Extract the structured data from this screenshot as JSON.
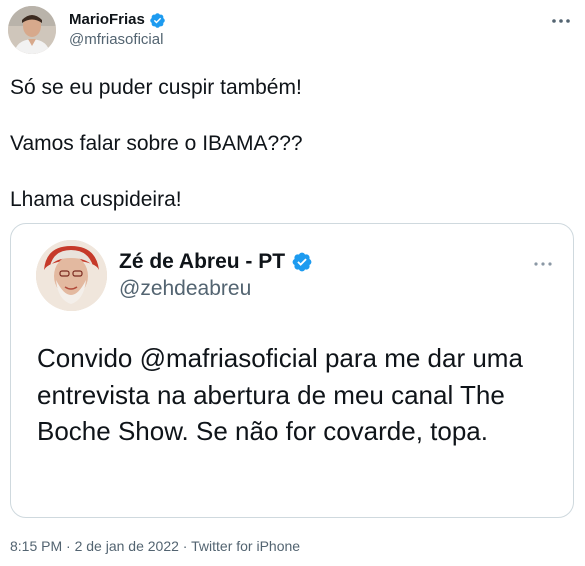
{
  "tweet": {
    "author": {
      "display_name": "MarioFrias",
      "handle": "@mfriasoficial",
      "verified_icon": "verified-badge-icon"
    },
    "more_icon": "more-options-icon",
    "text_lines": [
      "Só se eu puder cuspir também!",
      "Vamos falar sobre o IBAMA???",
      "Lhama cuspideira!"
    ],
    "quoted": {
      "author": {
        "display_name": "Zé de Abreu - PT",
        "handle": "@zehdeabreu",
        "verified_icon": "verified-badge-icon"
      },
      "more_icon": "more-options-icon",
      "text": "Convido @mafriasoficial para me dar uma entrevista na abertura de meu canal The Boche Show. Se não for covarde, topa."
    },
    "meta": {
      "time": "8:15 PM",
      "separator": " · ",
      "date": "2 de jan de 2022",
      "source": "Twitter for iPhone"
    }
  },
  "colors": {
    "text_primary": "#0f1419",
    "text_secondary": "#536471",
    "verified_blue": "#1d9bf0",
    "border": "#cfd9de"
  }
}
